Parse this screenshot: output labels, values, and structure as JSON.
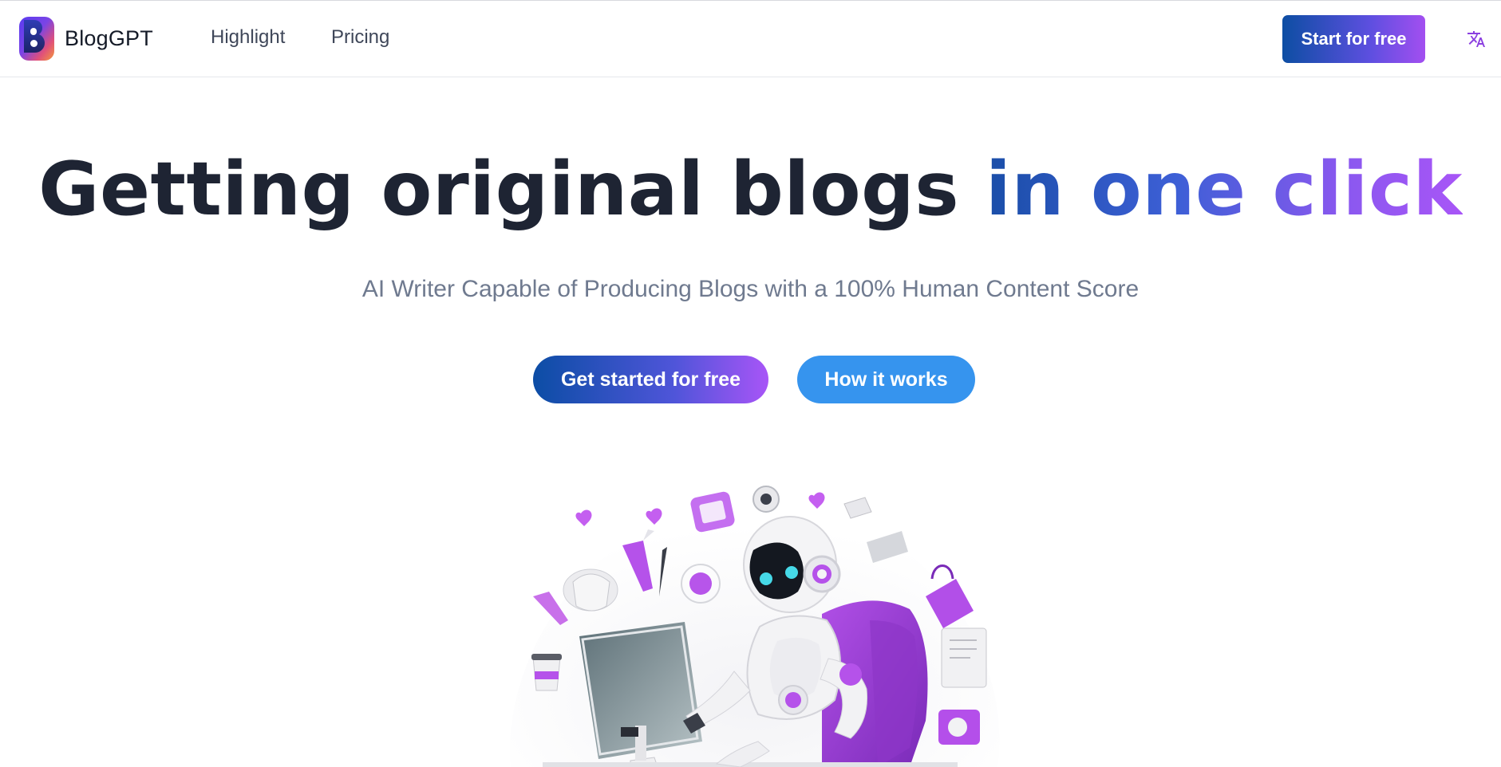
{
  "header": {
    "brand_name": "BlogGPT",
    "nav": [
      {
        "label": "Highlight"
      },
      {
        "label": "Pricing"
      }
    ],
    "cta_label": "Start for free",
    "language_icon": "translate-icon"
  },
  "hero": {
    "title_plain": "Getting original blogs ",
    "title_accent": "in one click",
    "subtitle": "AI Writer Capable of Producing Blogs with a 100% Human Content Score",
    "primary_cta": "Get started for free",
    "secondary_cta": "How it works",
    "illustration": "robot-writing-blog-illustration"
  },
  "colors": {
    "gradient_start": "#0d4ea3",
    "gradient_mid": "#5e4fe0",
    "gradient_end": "#a855f7",
    "secondary_button": "#3694ee",
    "title_text": "#1e2433",
    "subtitle_text": "#6f7a8f"
  }
}
